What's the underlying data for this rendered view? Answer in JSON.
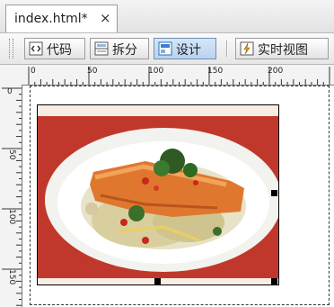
{
  "tab": {
    "title": "index.html*",
    "close_glyph": "×"
  },
  "toolbar": {
    "code_label": "代码",
    "split_label": "拆分",
    "design_label": "设计",
    "live_view_label": "实时视图",
    "active_view": "设计"
  },
  "ruler": {
    "horizontal_labels": [
      "0",
      "50",
      "100",
      "150",
      "200"
    ],
    "vertical_labels": [
      "0",
      "50",
      "100",
      "150"
    ]
  },
  "colors": {
    "accent": "#6f8fb4",
    "image_background": "#c0382b",
    "plate": "#ffffff"
  },
  "icons": {
    "code": "code-view-icon",
    "split": "split-view-icon",
    "design": "design-view-icon",
    "live": "live-view-icon"
  }
}
